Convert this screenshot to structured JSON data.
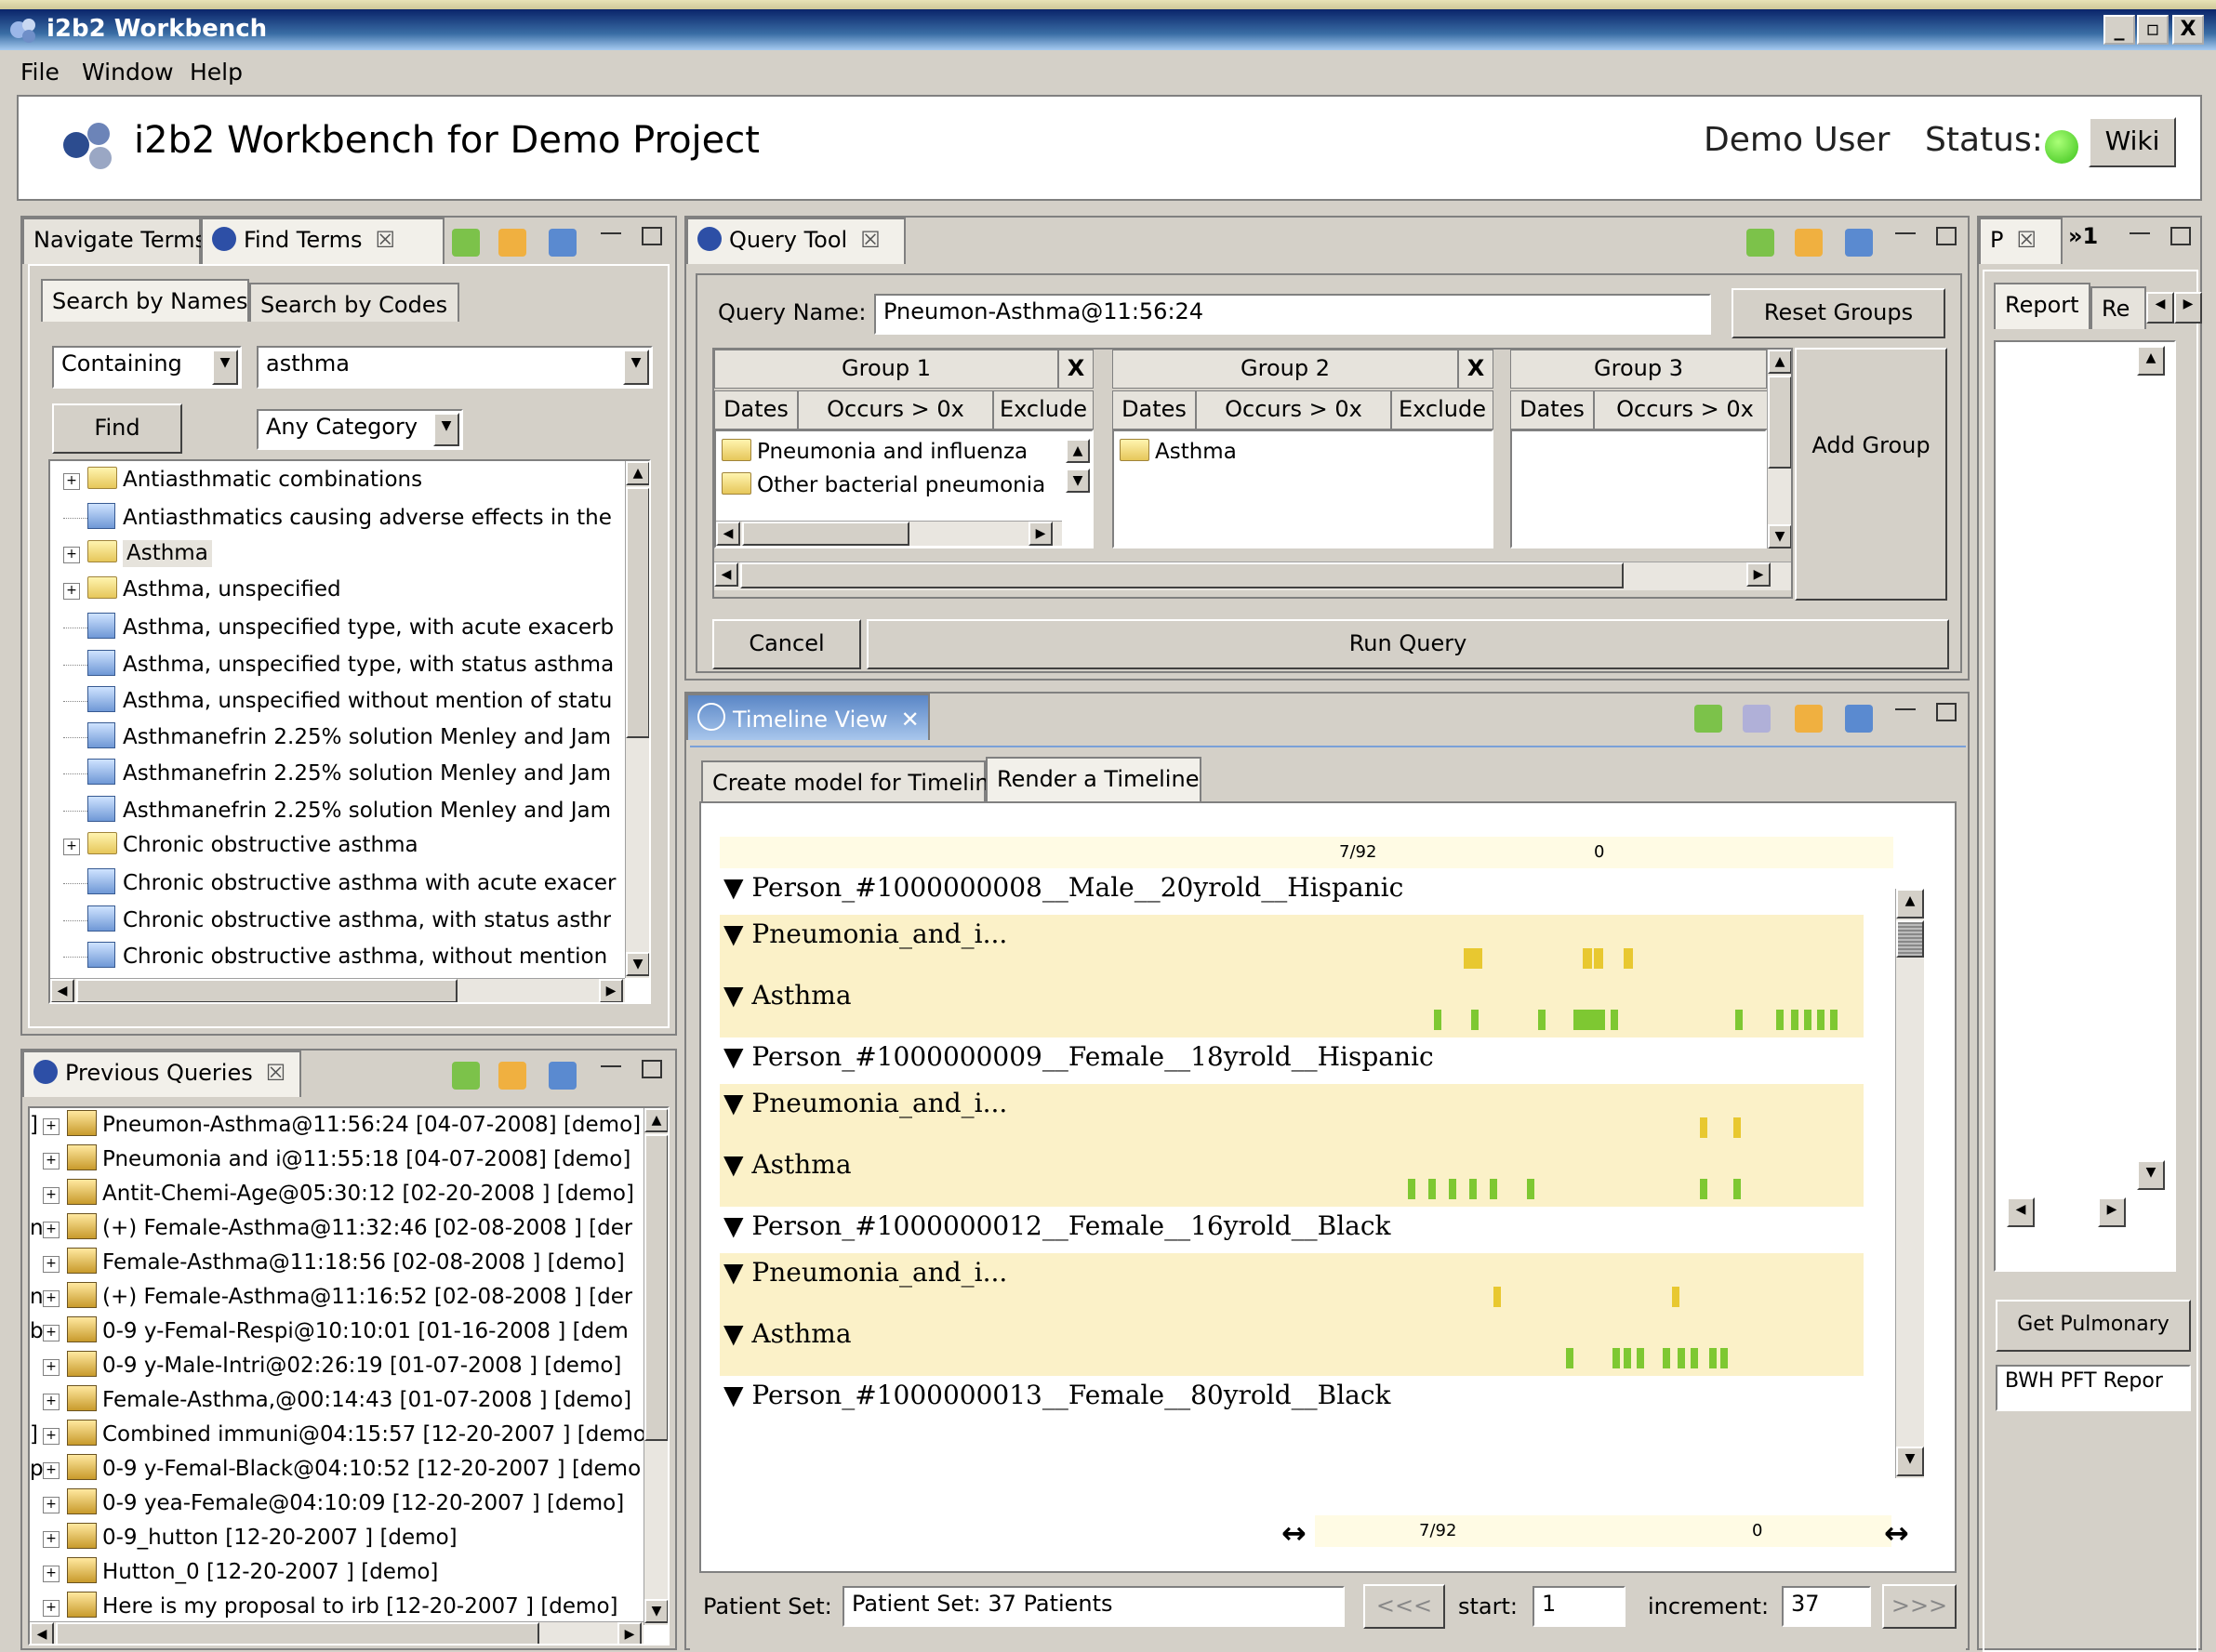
{
  "window": {
    "title": "i2b2 Workbench",
    "buttons": {
      "min": "_",
      "max": "▫",
      "close": "X"
    }
  },
  "menu": {
    "file": "File",
    "window": "Window",
    "help": "Help"
  },
  "banner": {
    "title": "i2b2 Workbench for Demo Project",
    "user": "Demo User",
    "status_label": "Status:",
    "status_color": "#3bc21a",
    "wiki": "Wiki"
  },
  "terms_panel": {
    "tabs": {
      "navigate": "Navigate Terms",
      "find": "Find Terms"
    },
    "subtabs": {
      "names": "Search by Names",
      "codes": "Search by Codes"
    },
    "match_mode": "Containing",
    "search_value": "asthma",
    "find_button": "Find",
    "category": "Any Category",
    "items": [
      {
        "label": "Antiasthmatic combinations",
        "type": "folder"
      },
      {
        "label": "Antiasthmatics causing adverse effects in the",
        "type": "leaf"
      },
      {
        "label": "Asthma",
        "type": "folder"
      },
      {
        "label": "Asthma, unspecified",
        "type": "folder"
      },
      {
        "label": "Asthma, unspecified type, with acute exacerb",
        "type": "leaf"
      },
      {
        "label": "Asthma, unspecified type, with status asthma",
        "type": "leaf"
      },
      {
        "label": "Asthma, unspecified without mention of statu",
        "type": "leaf"
      },
      {
        "label": "Asthmanefrin 2.25% solution Menley and Jam",
        "type": "leaf"
      },
      {
        "label": "Asthmanefrin 2.25% solution Menley and Jam",
        "type": "leaf"
      },
      {
        "label": "Asthmanefrin 2.25% solution Menley and Jam",
        "type": "leaf"
      },
      {
        "label": "Chronic obstructive asthma",
        "type": "folder"
      },
      {
        "label": "Chronic obstructive asthma with acute exacer",
        "type": "leaf"
      },
      {
        "label": "Chronic obstructive asthma, with status asthr",
        "type": "leaf"
      },
      {
        "label": "Chronic obstructive asthma, without mention",
        "type": "leaf"
      }
    ]
  },
  "previous_queries": {
    "title": "Previous Queries",
    "items": [
      {
        "prefix": "]",
        "label": "Pneumon-Asthma@11:56:24 [04-07-2008] [demo]"
      },
      {
        "prefix": "",
        "label": "Pneumonia and i@11:55:18 [04-07-2008] [demo]"
      },
      {
        "prefix": "",
        "label": "Antit-Chemi-Age@05:30:12 [02-20-2008 ] [demo]"
      },
      {
        "prefix": "n",
        "label": "(+) Female-Asthma@11:32:46 [02-08-2008 ] [der"
      },
      {
        "prefix": "",
        "label": "Female-Asthma@11:18:56 [02-08-2008 ] [demo]"
      },
      {
        "prefix": "n",
        "label": "(+) Female-Asthma@11:16:52 [02-08-2008 ] [der"
      },
      {
        "prefix": "b",
        "label": "0-9 y-Femal-Respi@10:10:01 [01-16-2008 ] [dem"
      },
      {
        "prefix": "",
        "label": "0-9 y-Male-Intri@02:26:19 [01-07-2008 ] [demo]"
      },
      {
        "prefix": "",
        "label": "Female-Asthma,@00:14:43 [01-07-2008 ] [demo]"
      },
      {
        "prefix": "]",
        "label": "Combined immuni@04:15:57 [12-20-2007 ] [demo"
      },
      {
        "prefix": "p",
        "label": "0-9 y-Femal-Black@04:10:52 [12-20-2007 ] [demo"
      },
      {
        "prefix": "",
        "label": "0-9 yea-Female@04:10:09 [12-20-2007 ] [demo]"
      },
      {
        "prefix": "",
        "label": "0-9_hutton [12-20-2007 ] [demo]"
      },
      {
        "prefix": "",
        "label": "Hutton_0 [12-20-2007 ] [demo]"
      },
      {
        "prefix": "",
        "label": "Here is my proposal to irb [12-20-2007 ] [demo]"
      }
    ]
  },
  "query_tool": {
    "title": "Query Tool",
    "name_label": "Query Name:",
    "name_value": "Pneumon-Asthma@11:56:24",
    "reset_button": "Reset Groups",
    "add_group_button": "Add Group",
    "cancel_button": "Cancel",
    "run_button": "Run Query",
    "groups": [
      {
        "title": "Group 1",
        "close": "X",
        "dates": "Dates",
        "occurs": "Occurs > 0x",
        "exclude": "Exclude",
        "items": [
          "Pneumonia and influenza",
          "Other bacterial pneumonia"
        ]
      },
      {
        "title": "Group 2",
        "close": "X",
        "dates": "Dates",
        "occurs": "Occurs > 0x",
        "exclude": "Exclude",
        "items": [
          "Asthma"
        ]
      },
      {
        "title": "Group 3",
        "dates": "Dates",
        "occurs": "Occurs > 0x",
        "items": []
      }
    ]
  },
  "timeline": {
    "title": "Timeline View",
    "tabs": {
      "create": "Create model for Timeline",
      "render": "Render a Timeline"
    },
    "scale_top": "7/92",
    "scale_top_right": "0",
    "scale_bottom": "7/92",
    "scale_bottom_right": "0",
    "rows": [
      {
        "kind": "person",
        "label": "▼ Person_#1000000008__Male__20yrold__Hispanic"
      },
      {
        "kind": "concept",
        "label": "▼ Pneumonia_and_i..."
      },
      {
        "kind": "concept",
        "label": "▼ Asthma"
      },
      {
        "kind": "person",
        "label": "▼ Person_#1000000009__Female__18yrold__Hispanic"
      },
      {
        "kind": "concept",
        "label": "▼ Pneumonia_and_i..."
      },
      {
        "kind": "concept",
        "label": "▼ Asthma"
      },
      {
        "kind": "person",
        "label": "▼ Person_#1000000012__Female__16yrold__Black"
      },
      {
        "kind": "concept",
        "label": "▼ Pneumonia_and_i..."
      },
      {
        "kind": "concept",
        "label": "▼ Asthma"
      },
      {
        "kind": "person",
        "label": "▼ Person_#1000000013__Female__80yrold__Black"
      }
    ],
    "event_colors": {
      "pneumonia": "#e8c830",
      "asthma": "#7ec832"
    },
    "patient_set_label": "Patient Set:",
    "patient_set_value": "Patient Set: 37 Patients",
    "prev_button": "<<<",
    "start_label": "start:",
    "start_value": "1",
    "increment_label": "increment:",
    "increment_value": "37",
    "next_button": ">>>"
  },
  "right_panel": {
    "tab_p": "P",
    "tab_more": "»1",
    "subtab_report": "Report",
    "subtab_re": "Re",
    "get_button": "Get Pulmonary",
    "field_value": "BWH PFT Repor"
  }
}
